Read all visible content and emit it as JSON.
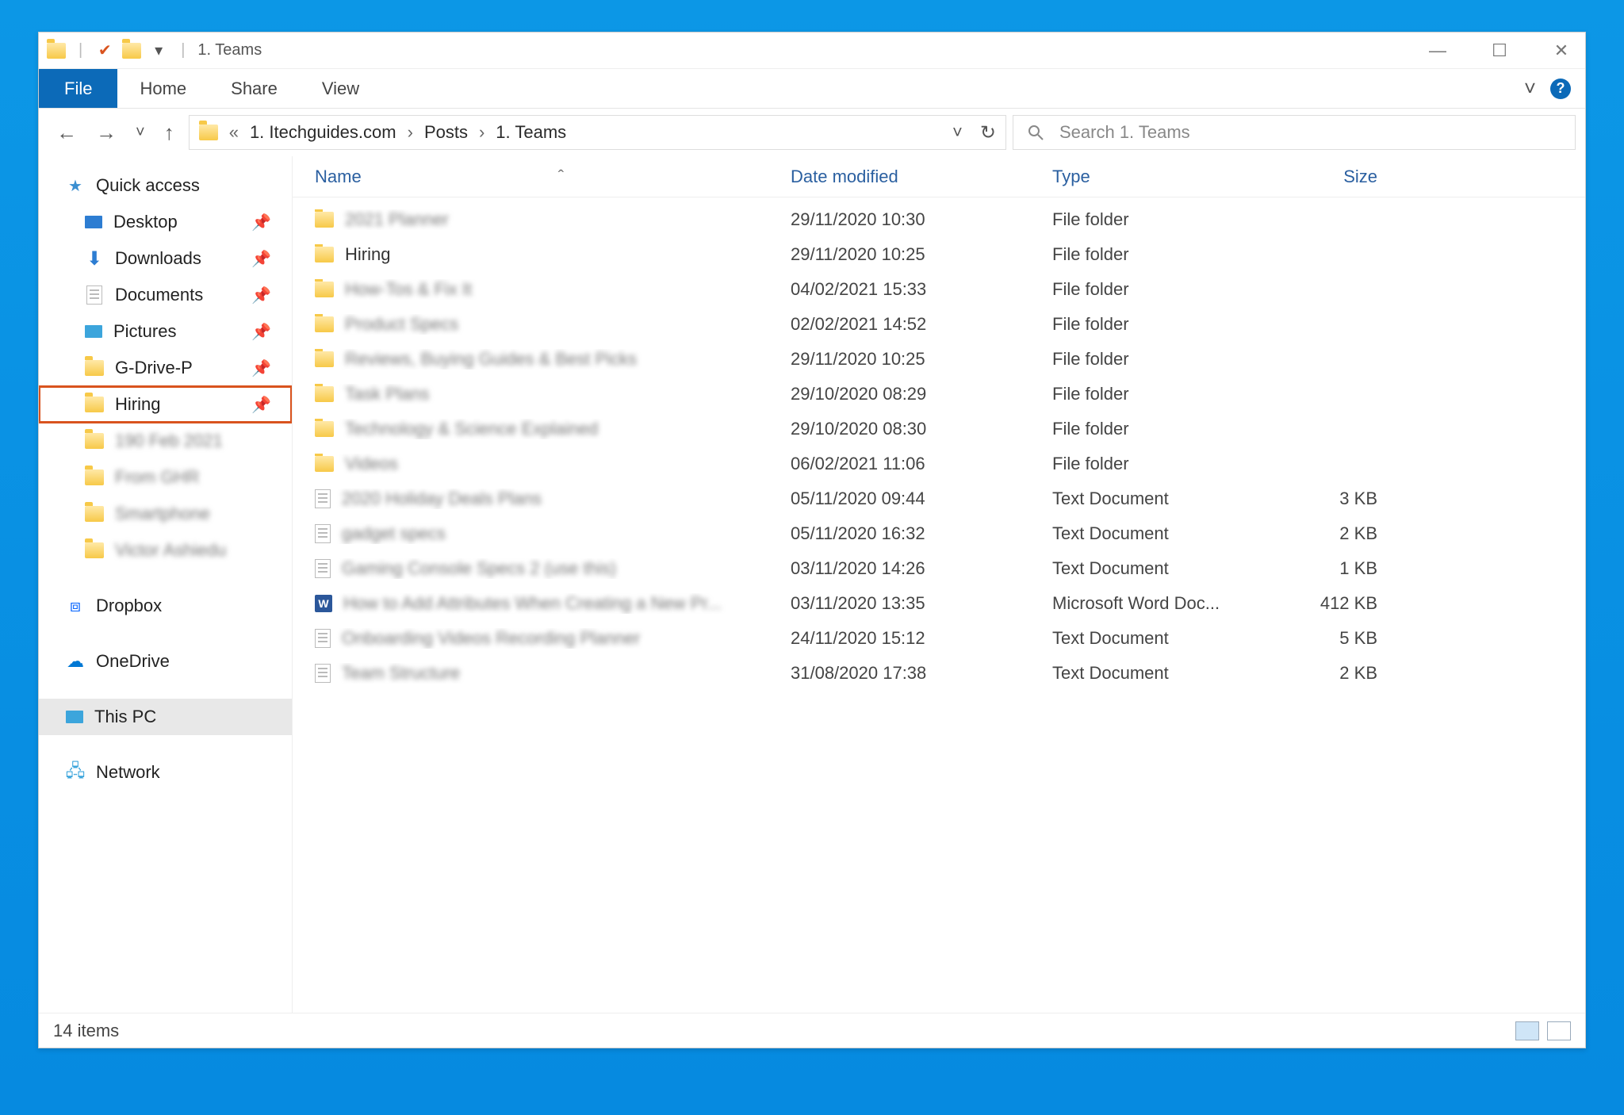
{
  "window": {
    "title": "1. Teams",
    "min": "—",
    "max": "☐",
    "close": "✕"
  },
  "ribbon": {
    "file": "File",
    "home": "Home",
    "share": "Share",
    "view": "View",
    "expand": "˅",
    "help": "?"
  },
  "nav": {
    "back": "←",
    "forward": "→",
    "recent": "˅",
    "up": "↑"
  },
  "address": {
    "prefix": "«",
    "crumb1": "1. Itechguides.com",
    "crumb2": "Posts",
    "crumb3": "1. Teams",
    "sep": "›",
    "drop": "˅",
    "refresh": "↻"
  },
  "search": {
    "placeholder": "Search 1. Teams"
  },
  "sidebar": {
    "quick": "Quick access",
    "desktop": "Desktop",
    "downloads": "Downloads",
    "documents": "Documents",
    "pictures": "Pictures",
    "gdrive": "G-Drive-P",
    "hiring": "Hiring",
    "qa1": "190 Feb 2021",
    "qa2": "From GHR",
    "qa3": "Smartphone",
    "qa4": "Victor Ashiedu",
    "dropbox": "Dropbox",
    "onedrive": "OneDrive",
    "thispc": "This PC",
    "network": "Network"
  },
  "columns": {
    "name": "Name",
    "date": "Date modified",
    "type": "Type",
    "size": "Size",
    "sort": "ˆ"
  },
  "rows": [
    {
      "icon": "folder",
      "name": "2021 Planner",
      "blur": true,
      "date": "29/11/2020 10:30",
      "type": "File folder",
      "size": ""
    },
    {
      "icon": "folder",
      "name": "Hiring",
      "blur": false,
      "date": "29/11/2020 10:25",
      "type": "File folder",
      "size": ""
    },
    {
      "icon": "folder",
      "name": "How-Tos & Fix It",
      "blur": true,
      "date": "04/02/2021 15:33",
      "type": "File folder",
      "size": ""
    },
    {
      "icon": "folder",
      "name": "Product Specs",
      "blur": true,
      "date": "02/02/2021 14:52",
      "type": "File folder",
      "size": ""
    },
    {
      "icon": "folder",
      "name": "Reviews, Buying Guides & Best Picks",
      "blur": true,
      "date": "29/11/2020 10:25",
      "type": "File folder",
      "size": ""
    },
    {
      "icon": "folder",
      "name": "Task Plans",
      "blur": true,
      "date": "29/10/2020 08:29",
      "type": "File folder",
      "size": ""
    },
    {
      "icon": "folder",
      "name": "Technology & Science Explained",
      "blur": true,
      "date": "29/10/2020 08:30",
      "type": "File folder",
      "size": ""
    },
    {
      "icon": "folder",
      "name": "Videos",
      "blur": true,
      "date": "06/02/2021 11:06",
      "type": "File folder",
      "size": ""
    },
    {
      "icon": "doc",
      "name": "2020 Holiday Deals Plans",
      "blur": true,
      "date": "05/11/2020 09:44",
      "type": "Text Document",
      "size": "3 KB"
    },
    {
      "icon": "doc",
      "name": "gadget specs",
      "blur": true,
      "date": "05/11/2020 16:32",
      "type": "Text Document",
      "size": "2 KB"
    },
    {
      "icon": "doc",
      "name": "Gaming Console Specs 2 (use this)",
      "blur": true,
      "date": "03/11/2020 14:26",
      "type": "Text Document",
      "size": "1 KB"
    },
    {
      "icon": "word",
      "name": "How to Add Attributes When Creating a New Pr...",
      "blur": true,
      "date": "03/11/2020 13:35",
      "type": "Microsoft Word Doc...",
      "size": "412 KB"
    },
    {
      "icon": "doc",
      "name": "Onboarding Videos Recording Planner",
      "blur": true,
      "date": "24/11/2020 15:12",
      "type": "Text Document",
      "size": "5 KB"
    },
    {
      "icon": "doc",
      "name": "Team Structure",
      "blur": true,
      "date": "31/08/2020 17:38",
      "type": "Text Document",
      "size": "2 KB"
    }
  ],
  "status": {
    "count": "14 items"
  }
}
